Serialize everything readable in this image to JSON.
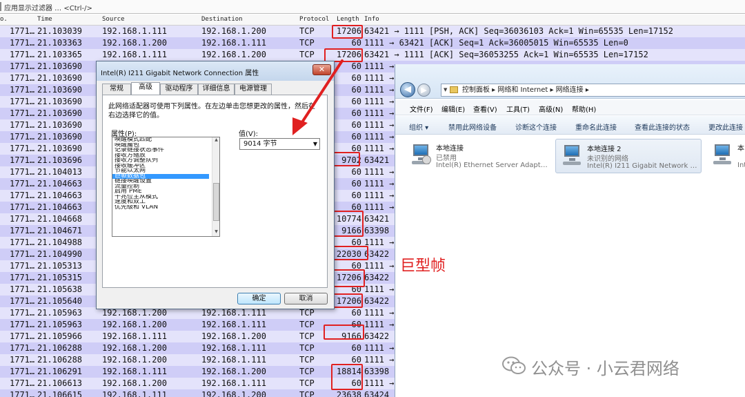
{
  "filter_bar": {
    "placeholder": "应用显示过滤器 … <Ctrl-/>"
  },
  "columns": {
    "no": "o.",
    "time": "Time",
    "source": "Source",
    "destination": "Destination",
    "protocol": "Protocol",
    "length": "Length",
    "info": "Info"
  },
  "packets": [
    {
      "no": "1771…",
      "time": "21.103039",
      "src": "192.168.1.111",
      "dst": "192.168.1.200",
      "proto": "TCP",
      "len": "17206",
      "info": "63421 → 1111 [PSH, ACK] Seq=36036103 Ack=1 Win=65535 Len=17152",
      "shade": "light"
    },
    {
      "no": "1771…",
      "time": "21.103363",
      "src": "192.168.1.200",
      "dst": "192.168.1.111",
      "proto": "TCP",
      "len": "60",
      "info": "1111 → 63421 [ACK] Seq=1 Ack=36005015 Win=65535 Len=0",
      "shade": "dark"
    },
    {
      "no": "1771…",
      "time": "21.103365",
      "src": "192.168.1.111",
      "dst": "192.168.1.200",
      "proto": "TCP",
      "len": "17206",
      "info": "63421 → 1111 [ACK] Seq=36053255 Ack=1 Win=65535 Len=17152",
      "shade": "light"
    },
    {
      "no": "1771…",
      "time": "21.103690",
      "src": "",
      "dst": "",
      "proto": "",
      "len": "60",
      "info": "1111 →",
      "shade": "dark"
    },
    {
      "no": "1771…",
      "time": "21.103690",
      "src": "",
      "dst": "",
      "proto": "",
      "len": "60",
      "info": "1111 →",
      "shade": "light"
    },
    {
      "no": "1771…",
      "time": "21.103690",
      "src": "",
      "dst": "",
      "proto": "",
      "len": "60",
      "info": "1111 →",
      "shade": "dark"
    },
    {
      "no": "1771…",
      "time": "21.103690",
      "src": "",
      "dst": "",
      "proto": "",
      "len": "60",
      "info": "1111 →",
      "shade": "light"
    },
    {
      "no": "1771…",
      "time": "21.103690",
      "src": "",
      "dst": "",
      "proto": "",
      "len": "60",
      "info": "1111 →",
      "shade": "dark"
    },
    {
      "no": "1771…",
      "time": "21.103690",
      "src": "",
      "dst": "",
      "proto": "",
      "len": "60",
      "info": "1111 →",
      "shade": "light"
    },
    {
      "no": "1771…",
      "time": "21.103690",
      "src": "",
      "dst": "",
      "proto": "",
      "len": "60",
      "info": "1111 →",
      "shade": "dark"
    },
    {
      "no": "1771…",
      "time": "21.103690",
      "src": "",
      "dst": "",
      "proto": "",
      "len": "60",
      "info": "1111 →",
      "shade": "light"
    },
    {
      "no": "1771…",
      "time": "21.103696",
      "src": "",
      "dst": "",
      "proto": "",
      "len": "9702",
      "info": "63421",
      "shade": "dark"
    },
    {
      "no": "1771…",
      "time": "21.104013",
      "src": "",
      "dst": "",
      "proto": "",
      "len": "60",
      "info": "1111 →",
      "shade": "light"
    },
    {
      "no": "1771…",
      "time": "21.104663",
      "src": "",
      "dst": "",
      "proto": "",
      "len": "60",
      "info": "1111 →",
      "shade": "dark"
    },
    {
      "no": "1771…",
      "time": "21.104663",
      "src": "",
      "dst": "",
      "proto": "",
      "len": "60",
      "info": "1111 →",
      "shade": "light"
    },
    {
      "no": "1771…",
      "time": "21.104663",
      "src": "",
      "dst": "",
      "proto": "",
      "len": "60",
      "info": "1111 →",
      "shade": "dark"
    },
    {
      "no": "1771…",
      "time": "21.104668",
      "src": "",
      "dst": "",
      "proto": "",
      "len": "10774",
      "info": "63421",
      "shade": "light"
    },
    {
      "no": "1771…",
      "time": "21.104671",
      "src": "",
      "dst": "",
      "proto": "",
      "len": "9166",
      "info": "63398",
      "shade": "dark"
    },
    {
      "no": "1771…",
      "time": "21.104988",
      "src": "",
      "dst": "",
      "proto": "",
      "len": "60",
      "info": "1111 →",
      "shade": "light"
    },
    {
      "no": "1771…",
      "time": "21.104990",
      "src": "",
      "dst": "",
      "proto": "",
      "len": "22030",
      "info": "63422",
      "shade": "dark"
    },
    {
      "no": "1771…",
      "time": "21.105313",
      "src": "",
      "dst": "",
      "proto": "",
      "len": "60",
      "info": "1111 →",
      "shade": "light"
    },
    {
      "no": "1771…",
      "time": "21.105315",
      "src": "",
      "dst": "",
      "proto": "",
      "len": "17206",
      "info": "63422",
      "shade": "dark"
    },
    {
      "no": "1771…",
      "time": "21.105638",
      "src": "",
      "dst": "",
      "proto": "",
      "len": "60",
      "info": "1111 →",
      "shade": "light"
    },
    {
      "no": "1771…",
      "time": "21.105640",
      "src": "",
      "dst": "",
      "proto": "",
      "len": "17206",
      "info": "63422",
      "shade": "dark"
    },
    {
      "no": "1771…",
      "time": "21.105963",
      "src": "192.168.1.200",
      "dst": "192.168.1.111",
      "proto": "TCP",
      "len": "60",
      "info": "1111 →",
      "shade": "light"
    },
    {
      "no": "1771…",
      "time": "21.105963",
      "src": "192.168.1.200",
      "dst": "192.168.1.111",
      "proto": "TCP",
      "len": "60",
      "info": "1111 →",
      "shade": "dark"
    },
    {
      "no": "1771…",
      "time": "21.105966",
      "src": "192.168.1.111",
      "dst": "192.168.1.200",
      "proto": "TCP",
      "len": "9166",
      "info": "63422",
      "shade": "light"
    },
    {
      "no": "1771…",
      "time": "21.106288",
      "src": "192.168.1.200",
      "dst": "192.168.1.111",
      "proto": "TCP",
      "len": "60",
      "info": "1111 →",
      "shade": "dark"
    },
    {
      "no": "1771…",
      "time": "21.106288",
      "src": "192.168.1.200",
      "dst": "192.168.1.111",
      "proto": "TCP",
      "len": "60",
      "info": "1111 →",
      "shade": "light"
    },
    {
      "no": "1771…",
      "time": "21.106291",
      "src": "192.168.1.111",
      "dst": "192.168.1.200",
      "proto": "TCP",
      "len": "18814",
      "info": "63398",
      "shade": "dark"
    },
    {
      "no": "1771…",
      "time": "21.106613",
      "src": "192.168.1.200",
      "dst": "192.168.1.111",
      "proto": "TCP",
      "len": "60",
      "info": "1111 →",
      "shade": "light"
    },
    {
      "no": "1771…",
      "time": "21.106615",
      "src": "192.168.1.111",
      "dst": "192.168.1.200",
      "proto": "TCP",
      "len": "23638",
      "info": "63424",
      "shade": "dark"
    }
  ],
  "dialog": {
    "title": "Intel(R) I211 Gigabit Network Connection 属性",
    "close": "✕",
    "tabs": [
      "常规",
      "高级",
      "驱动程序",
      "详细信息",
      "电源管理"
    ],
    "active_tab": "高级",
    "description": "此网络适配器可使用下列属性。在左边单击您想更改的属性，然后在右边选择它的值。",
    "property_label": "属性(P):",
    "value_label": "值(V):",
    "properties": [
      "唤醒模式匹配",
      "唤醒魔包",
      "记录链接状态事件",
      "接收方缩放",
      "接收方调整队列",
      "接收缓冲区",
      "节能以太网",
      "巨帧数据包",
      "链接唤醒设置",
      "流量控制",
      "启用 PME",
      "千兆位主从模式",
      "速度和双工",
      "优先级和 VLAN"
    ],
    "selected_property": "巨帧数据包",
    "value": "9014 字节",
    "ok": "确定",
    "cancel": "取消"
  },
  "network_window": {
    "breadcrumb": "控制面板  ▸  网络和 Internet  ▸  网络连接  ▸",
    "menu": [
      "文件(F)",
      "编辑(E)",
      "查看(V)",
      "工具(T)",
      "高级(N)",
      "帮助(H)"
    ],
    "toolbar": [
      "组织 ▾",
      "禁用此网络设备",
      "诊断这个连接",
      "重命名此连接",
      "查看此连接的状态",
      "更改此连接"
    ],
    "adapters": [
      {
        "name": "本地连接",
        "status": "已禁用",
        "device": "Intel(R) Ethernet Server Adapt…"
      },
      {
        "name": "本地连接 2",
        "status": "未识别的网络",
        "device": "Intel(R) I211 Gigabit Network …"
      },
      {
        "name": "本",
        "status": "",
        "device": "Int"
      }
    ]
  },
  "annotation": {
    "label": "巨型帧",
    "color": "#e02020"
  },
  "watermark": {
    "text": "公众号 · 小云君网络"
  }
}
